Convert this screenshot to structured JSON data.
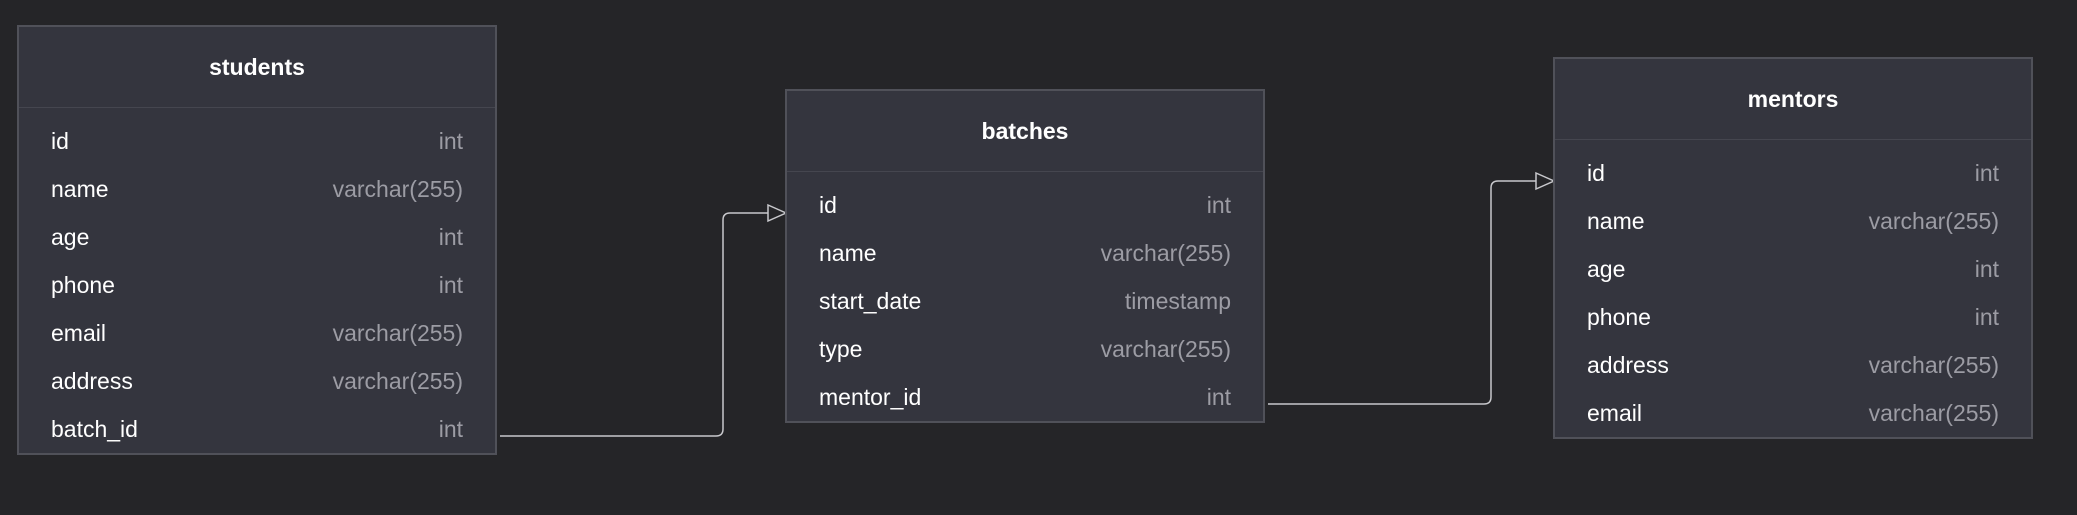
{
  "tables": [
    {
      "name": "students",
      "columns": [
        {
          "name": "id",
          "type": "int"
        },
        {
          "name": "name",
          "type": "varchar(255)"
        },
        {
          "name": "age",
          "type": "int"
        },
        {
          "name": "phone",
          "type": "int"
        },
        {
          "name": "email",
          "type": "varchar(255)"
        },
        {
          "name": "address",
          "type": "varchar(255)"
        },
        {
          "name": "batch_id",
          "type": "int"
        }
      ]
    },
    {
      "name": "batches",
      "columns": [
        {
          "name": "id",
          "type": "int"
        },
        {
          "name": "name",
          "type": "varchar(255)"
        },
        {
          "name": "start_date",
          "type": "timestamp"
        },
        {
          "name": "type",
          "type": "varchar(255)"
        },
        {
          "name": "mentor_id",
          "type": "int"
        }
      ]
    },
    {
      "name": "mentors",
      "columns": [
        {
          "name": "id",
          "type": "int"
        },
        {
          "name": "name",
          "type": "varchar(255)"
        },
        {
          "name": "age",
          "type": "int"
        },
        {
          "name": "phone",
          "type": "int"
        },
        {
          "name": "address",
          "type": "varchar(255)"
        },
        {
          "name": "email",
          "type": "varchar(255)"
        }
      ]
    }
  ],
  "relations": [
    {
      "from": "students.batch_id",
      "to": "batches.id"
    },
    {
      "from": "batches.mentor_id",
      "to": "mentors.id"
    }
  ],
  "colors": {
    "background": "#252528",
    "table_fill": "#34353e",
    "table_border": "#505159",
    "column_name": "#ffffff",
    "column_type": "#9c9ca4",
    "connector": "#c8c8cc"
  }
}
